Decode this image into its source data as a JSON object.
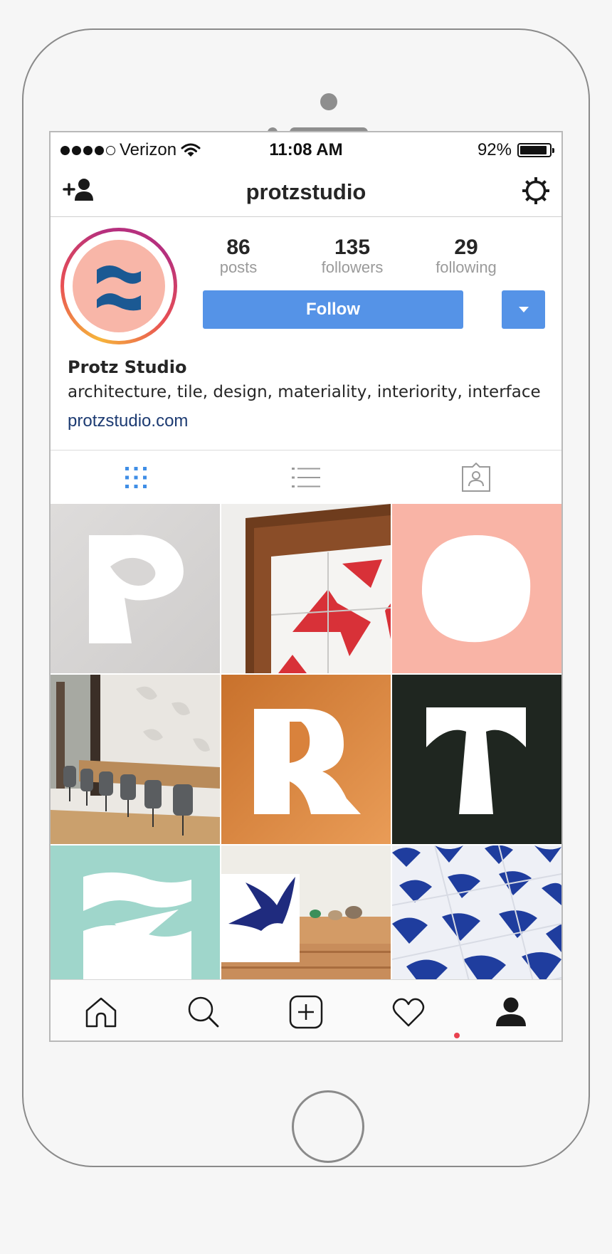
{
  "status_bar": {
    "carrier": "Verizon",
    "time": "11:08 AM",
    "battery": "92%",
    "signal_dots_filled": 4,
    "signal_dots_total": 5,
    "battery_level": 0.92
  },
  "nav": {
    "title": "protzstudio",
    "left_icon": "add-user-icon",
    "right_icon": "settings-gear-icon"
  },
  "profile": {
    "stats": [
      {
        "value": "86",
        "label": "posts"
      },
      {
        "value": "135",
        "label": "followers"
      },
      {
        "value": "29",
        "label": "following"
      }
    ],
    "follow_label": "Follow",
    "name": "Protz Studio",
    "bio": "architecture, tile, design, materiality, interiority, interface",
    "link": "protzstudio.com"
  },
  "tabs": [
    {
      "icon": "grid-icon",
      "active": true
    },
    {
      "icon": "list-icon",
      "active": false
    },
    {
      "icon": "tagged-photos-icon",
      "active": false
    }
  ],
  "bottom_bar": [
    {
      "icon": "home-icon"
    },
    {
      "icon": "search-icon"
    },
    {
      "icon": "new-post-icon"
    },
    {
      "icon": "activity-heart-icon",
      "notification": true
    },
    {
      "icon": "profile-icon"
    }
  ],
  "colors": {
    "follow_button": "#5593e7",
    "link": "#1d3b72",
    "active_tab": "#3f8ee6",
    "notification": "#e9424f"
  }
}
